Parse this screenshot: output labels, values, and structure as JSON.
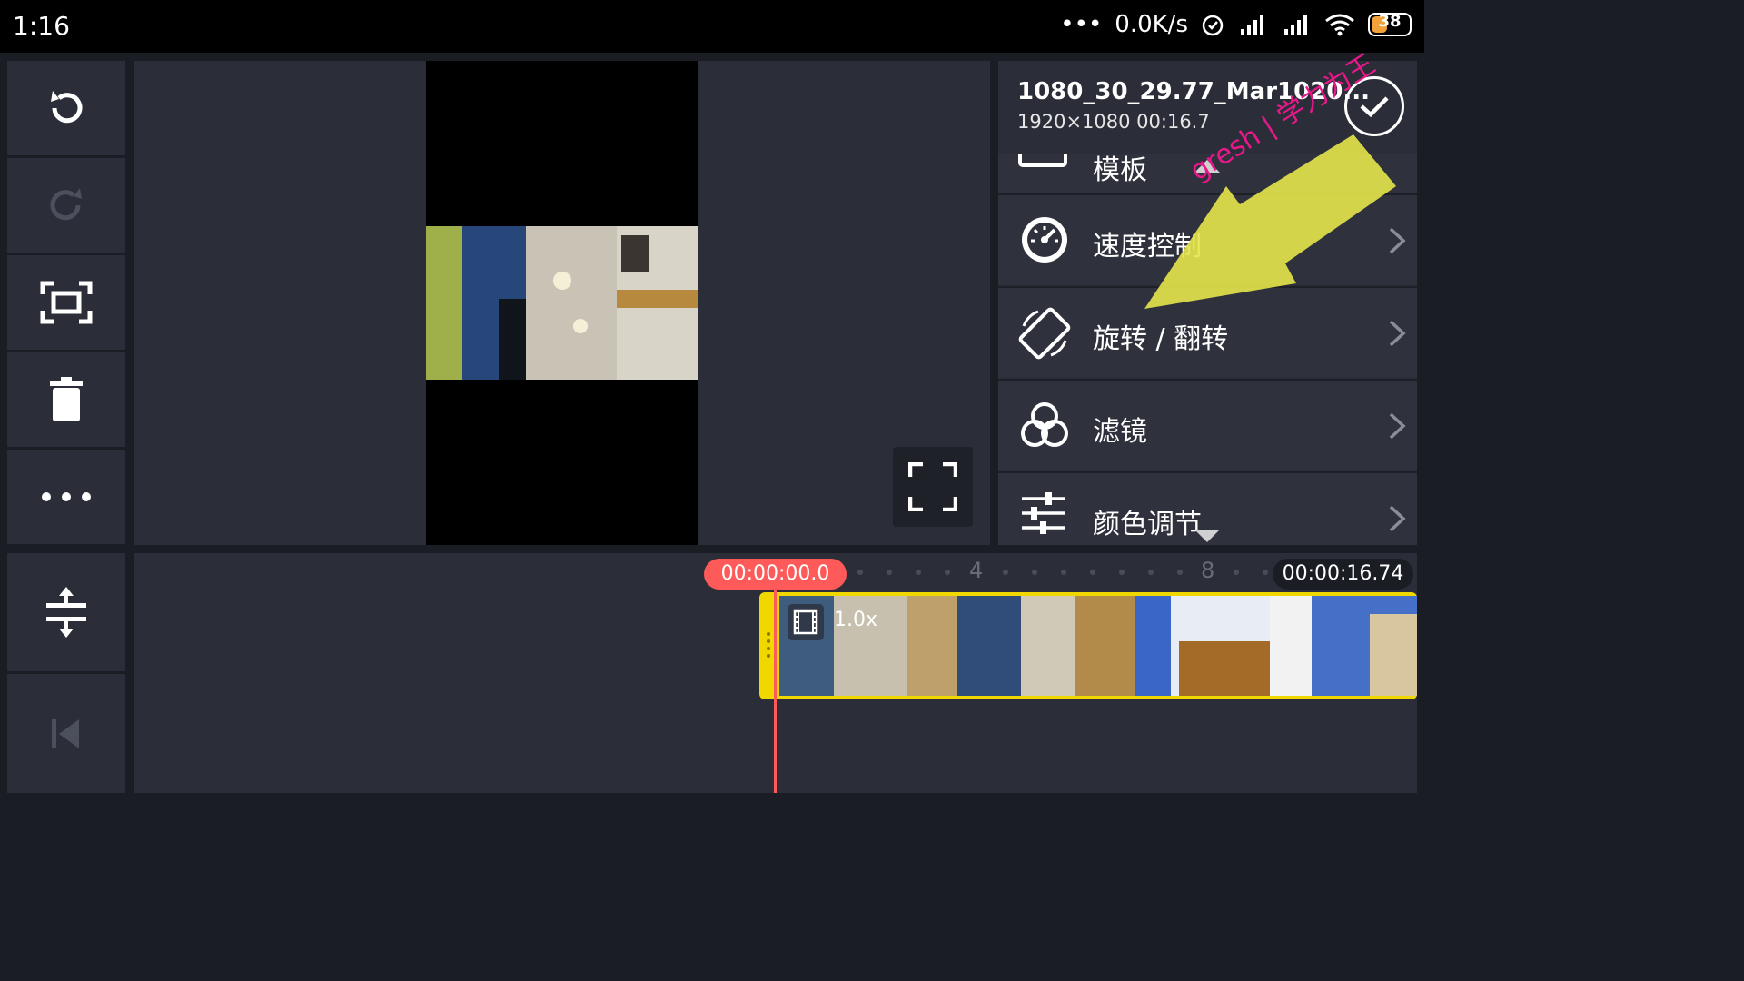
{
  "status_bar": {
    "time": "1:16",
    "dots": "•••",
    "network_speed": "0.0K/s",
    "battery": "38"
  },
  "preview": {},
  "panel": {
    "clip_name": "1080_30_29.77_Mar1020...",
    "clip_meta": "1920×1080  00:16.7",
    "partial_item": "模板",
    "items": [
      {
        "label": "速度控制",
        "icon": "speedometer-icon"
      },
      {
        "label": "旋转 / 翻转",
        "icon": "rotate-flip-icon"
      },
      {
        "label": "滤镜",
        "icon": "filter-icon"
      },
      {
        "label": "颜色调节",
        "icon": "sliders-icon"
      }
    ]
  },
  "timeline": {
    "current_time": "00:00:00.0",
    "total_time": "00:00:16.74",
    "tick_4": "4",
    "tick_8": "8",
    "speed_label": "1.0x"
  },
  "watermark": "gresh | 学力为王",
  "colors": {
    "accent_red": "#ff5a5a",
    "clip_yellow": "#f0d700",
    "panel_bg": "#2b2e38",
    "battery": "#f3a23a"
  }
}
